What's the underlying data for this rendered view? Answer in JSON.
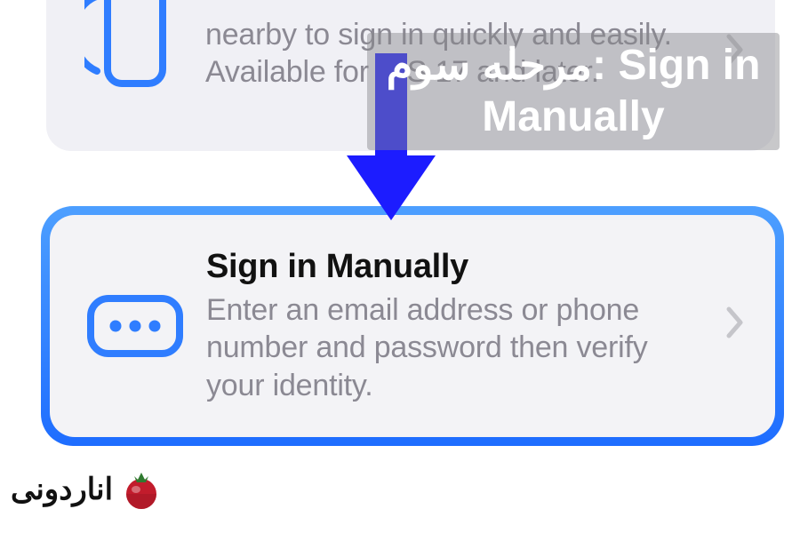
{
  "top_card": {
    "description": "nearby to sign in quickly and easily. Available for iOS 17 and later."
  },
  "highlight_card": {
    "title": "Sign in Manually",
    "description": "Enter an email address or phone number and password then verify your identity."
  },
  "overlay": {
    "caption_prefix": "مرحله سوم: ",
    "caption_main": "Sign in Manually"
  },
  "watermark": {
    "brand": "اناردونی"
  },
  "colors": {
    "accent_blue": "#2f7dff",
    "arrow_blue": "#1c1cff",
    "card_bg": "#f0f0f5",
    "text_muted": "#8b8993"
  },
  "icons": {
    "phone": "phone-icon",
    "password": "password-dots-icon",
    "chevron": "chevron-right-icon",
    "arrow": "down-arrow-icon",
    "pomegranate": "pomegranate-icon"
  }
}
